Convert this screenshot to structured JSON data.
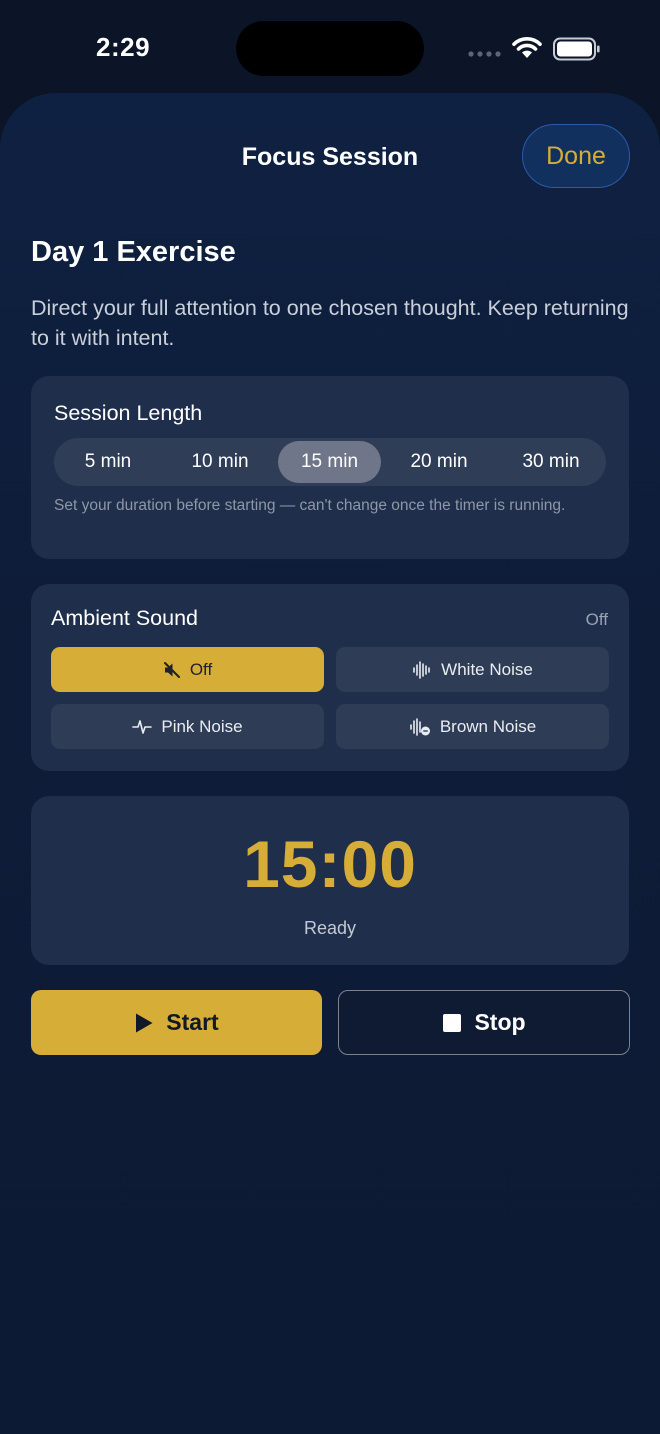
{
  "status_bar": {
    "time": "2:29"
  },
  "header": {
    "title": "Focus Session",
    "done_label": "Done"
  },
  "exercise": {
    "title": "Day 1 Exercise",
    "description": "Direct your full attention to one chosen thought. Keep returning to it with intent."
  },
  "session_length": {
    "title": "Session Length",
    "options": [
      "5 min",
      "10 min",
      "15 min",
      "20 min",
      "30 min"
    ],
    "selected": "15 min",
    "note": "Set your duration before starting — can't change once the timer is running."
  },
  "ambient_sound": {
    "title": "Ambient Sound",
    "status": "Off",
    "options": [
      {
        "label": "Off",
        "icon": "speaker-muted-icon"
      },
      {
        "label": "White Noise",
        "icon": "waveform-icon"
      },
      {
        "label": "Pink Noise",
        "icon": "heartbeat-wave-icon"
      },
      {
        "label": "Brown Noise",
        "icon": "waveform-minus-icon"
      }
    ],
    "selected": "Off"
  },
  "timer": {
    "value": "15:00",
    "status": "Ready"
  },
  "actions": {
    "start_label": "Start",
    "stop_label": "Stop"
  },
  "colors": {
    "background": "#0b1527",
    "card": "#1f2e4a",
    "accent_gold": "#d6ad36",
    "segment_selected": "#6f7689"
  }
}
